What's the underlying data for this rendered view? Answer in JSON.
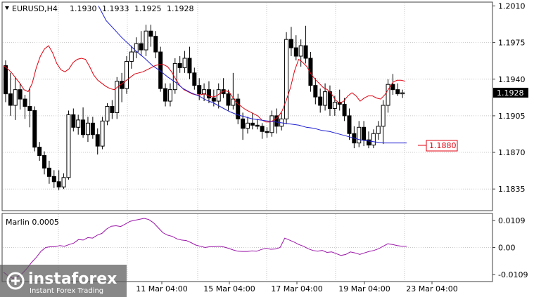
{
  "header": {
    "symbol": "EURUSD,H4",
    "open": "1.1930",
    "high": "1.1933",
    "low": "1.1925",
    "close": "1.1928"
  },
  "indicator": {
    "label": "Marlin 0.0005"
  },
  "watermark": {
    "brand": "instaforex",
    "tagline": "Instant Forex Trading"
  },
  "colors": {
    "background": "#ffffff",
    "plot_background": "#ffffff",
    "grid": "#c8c8c8",
    "candle": "#000000",
    "red_line": "#e0000f",
    "blue_line": "#1e1ed2",
    "oscillator": "#9b16a8",
    "price_tag_bg": "#000000",
    "level_tag": "#e0000f"
  },
  "chart_data": [
    {
      "type": "candlestick",
      "title": "EURUSD,H4",
      "y_ticks": [
        "1.2010",
        "1.1975",
        "1.1940",
        "1.1905",
        "1.1870",
        "1.1835"
      ],
      "x_ticks": [
        "11 Mar 04:00",
        "15 Mar 04:00",
        "17 Mar 04:00",
        "19 Mar 04:00",
        "23 Mar 04:00"
      ],
      "ylim": [
        1.1815,
        1.2013
      ],
      "grid": true,
      "current_price": "1.1928",
      "level_label": "1.1880",
      "ohlc": [
        [
          1.1953,
          1.1958,
          1.1918,
          1.1926
        ],
        [
          1.1926,
          1.1946,
          1.1905,
          1.1915
        ],
        [
          1.1915,
          1.1942,
          1.1901,
          1.193
        ],
        [
          1.193,
          1.1936,
          1.1911,
          1.1921
        ],
        [
          1.1921,
          1.1925,
          1.1902,
          1.1914
        ],
        [
          1.1914,
          1.1932,
          1.1894,
          1.191
        ],
        [
          1.191,
          1.1914,
          1.1871,
          1.1875
        ],
        [
          1.1875,
          1.188,
          1.1862,
          1.1867
        ],
        [
          1.1867,
          1.1871,
          1.1849,
          1.1855
        ],
        [
          1.1855,
          1.1862,
          1.184,
          1.1847
        ],
        [
          1.1847,
          1.1853,
          1.1836,
          1.1842
        ],
        [
          1.1842,
          1.1853,
          1.1834,
          1.1837
        ],
        [
          1.1837,
          1.185,
          1.1835,
          1.1846
        ],
        [
          1.1846,
          1.191,
          1.1844,
          1.1906
        ],
        [
          1.1906,
          1.1912,
          1.189,
          1.1894
        ],
        [
          1.1894,
          1.1906,
          1.1887,
          1.1901
        ],
        [
          1.1901,
          1.1913,
          1.1884,
          1.1887
        ],
        [
          1.1887,
          1.1904,
          1.188,
          1.1898
        ],
        [
          1.1898,
          1.1904,
          1.1883,
          1.1887
        ],
        [
          1.1887,
          1.1893,
          1.1868,
          1.1876
        ],
        [
          1.1876,
          1.1904,
          1.1873,
          1.19
        ],
        [
          1.19,
          1.1917,
          1.1896,
          1.1914
        ],
        [
          1.1914,
          1.192,
          1.1902,
          1.1908
        ],
        [
          1.1908,
          1.1942,
          1.1902,
          1.1938
        ],
        [
          1.1938,
          1.1946,
          1.1918,
          1.1931
        ],
        [
          1.1931,
          1.1962,
          1.1926,
          1.1957
        ],
        [
          1.1957,
          1.1972,
          1.195,
          1.1966
        ],
        [
          1.1966,
          1.198,
          1.196,
          1.1974
        ],
        [
          1.1974,
          1.1986,
          1.1962,
          1.1968
        ],
        [
          1.1968,
          1.1992,
          1.1962,
          1.1986
        ],
        [
          1.1986,
          1.1992,
          1.1971,
          1.1981
        ],
        [
          1.1981,
          1.1986,
          1.196,
          1.1966
        ],
        [
          1.1966,
          1.1971,
          1.1928,
          1.1931
        ],
        [
          1.1931,
          1.1936,
          1.1914,
          1.1919
        ],
        [
          1.1919,
          1.1936,
          1.1914,
          1.193
        ],
        [
          1.193,
          1.196,
          1.1926,
          1.1955
        ],
        [
          1.1955,
          1.1962,
          1.1946,
          1.1951
        ],
        [
          1.1951,
          1.1967,
          1.1946,
          1.196
        ],
        [
          1.196,
          1.1971,
          1.194,
          1.1946
        ],
        [
          1.1946,
          1.1951,
          1.193,
          1.1934
        ],
        [
          1.1934,
          1.1941,
          1.192,
          1.1926
        ],
        [
          1.1926,
          1.1936,
          1.1919,
          1.193
        ],
        [
          1.193,
          1.1938,
          1.1917,
          1.1922
        ],
        [
          1.1922,
          1.193,
          1.1914,
          1.1919
        ],
        [
          1.1919,
          1.1936,
          1.1912,
          1.193
        ],
        [
          1.193,
          1.1941,
          1.1922,
          1.1926
        ],
        [
          1.1926,
          1.193,
          1.191,
          1.1915
        ],
        [
          1.1915,
          1.1946,
          1.1911,
          1.1921
        ],
        [
          1.1921,
          1.1926,
          1.1897,
          1.1902
        ],
        [
          1.1902,
          1.1908,
          1.1882,
          1.1893
        ],
        [
          1.1893,
          1.1904,
          1.1888,
          1.1898
        ],
        [
          1.1898,
          1.1908,
          1.1892,
          1.1896
        ],
        [
          1.1896,
          1.1902,
          1.1892,
          1.1895
        ],
        [
          1.1895,
          1.1898,
          1.1883,
          1.189
        ],
        [
          1.189,
          1.1894,
          1.1884,
          1.1889
        ],
        [
          1.1889,
          1.191,
          1.1885,
          1.1905
        ],
        [
          1.1905,
          1.1912,
          1.1888,
          1.1895
        ],
        [
          1.1895,
          1.1908,
          1.1891,
          1.1902
        ],
        [
          1.1902,
          1.1985,
          1.1897,
          1.1978
        ],
        [
          1.1978,
          1.199,
          1.1962,
          1.197
        ],
        [
          1.197,
          1.1982,
          1.1958,
          1.1962
        ],
        [
          1.1962,
          1.1978,
          1.1952,
          1.1972
        ],
        [
          1.1972,
          1.1991,
          1.1955,
          1.196
        ],
        [
          1.196,
          1.1966,
          1.1928,
          1.1934
        ],
        [
          1.1934,
          1.1941,
          1.1916,
          1.1923
        ],
        [
          1.1923,
          1.1931,
          1.1908,
          1.1915
        ],
        [
          1.1915,
          1.1936,
          1.191,
          1.1928
        ],
        [
          1.1928,
          1.1934,
          1.1905,
          1.1912
        ],
        [
          1.1912,
          1.1924,
          1.1905,
          1.1918
        ],
        [
          1.1918,
          1.193,
          1.191,
          1.1916
        ],
        [
          1.1916,
          1.1922,
          1.19,
          1.1905
        ],
        [
          1.1905,
          1.1912,
          1.1882,
          1.1888
        ],
        [
          1.1888,
          1.1895,
          1.1874,
          1.1879
        ],
        [
          1.1879,
          1.19,
          1.1875,
          1.1894
        ],
        [
          1.1894,
          1.19,
          1.1876,
          1.1882
        ],
        [
          1.1882,
          1.189,
          1.1874,
          1.1877
        ],
        [
          1.1877,
          1.1892,
          1.1874,
          1.1888
        ],
        [
          1.1888,
          1.19,
          1.1882,
          1.1895
        ],
        [
          1.1895,
          1.192,
          1.1878,
          1.1915
        ],
        [
          1.1915,
          1.194,
          1.1908,
          1.1935
        ],
        [
          1.1935,
          1.1945,
          1.1925,
          1.193
        ],
        [
          1.193,
          1.1936,
          1.1924,
          1.1926
        ],
        [
          1.1926,
          1.193,
          1.1922,
          1.1927
        ]
      ],
      "red_line": [
        1.1953,
        1.195,
        1.1946,
        1.1941,
        1.1936,
        1.193,
        1.1928,
        1.1936,
        1.1951,
        1.1962,
        1.1969,
        1.1972,
        1.1965,
        1.1955,
        1.1949,
        1.1947,
        1.195,
        1.1956,
        1.1959,
        1.196,
        1.1959,
        1.1952,
        1.1944,
        1.1939,
        1.1936,
        1.1933,
        1.1931,
        1.193,
        1.1933,
        1.1936,
        1.1939,
        1.1942,
        1.1945,
        1.1946,
        1.1947,
        1.1949,
        1.1951,
        1.1953,
        1.1954,
        1.1954,
        1.1952,
        1.1947,
        1.194,
        1.1934,
        1.193,
        1.1928,
        1.1926,
        1.1925,
        1.1925,
        1.1926,
        1.1924,
        1.1923,
        1.1924,
        1.1927,
        1.1929,
        1.1928,
        1.1922,
        1.1917,
        1.1914,
        1.1911,
        1.1909,
        1.1907,
        1.1905,
        1.1901,
        1.1899,
        1.1899,
        1.1901,
        1.1904,
        1.191,
        1.192,
        1.1932,
        1.1948,
        1.1959,
        1.1956,
        1.1952,
        1.1945,
        1.194,
        1.1936,
        1.1932,
        1.193,
        1.1926,
        1.192,
        1.1917,
        1.1919,
        1.1924,
        1.1927,
        1.1924,
        1.1919,
        1.1922,
        1.1924,
        1.1924,
        1.1922,
        1.1921,
        1.1925,
        1.1931,
        1.1937,
        1.1939,
        1.1939,
        1.1938
      ],
      "blue_line": [
        1.201,
        1.1996,
        1.1988,
        1.198,
        1.1973,
        1.1966,
        1.196,
        1.1953,
        1.1948,
        1.1942,
        1.1937,
        1.1931,
        1.1927,
        1.1924,
        1.192,
        1.1917,
        1.1913,
        1.1909,
        1.1906,
        1.1904,
        1.1902,
        1.1901,
        1.19,
        1.1899,
        1.1898,
        1.1897,
        1.1896,
        1.1894,
        1.1893,
        1.1891,
        1.189,
        1.1888,
        1.1886,
        1.1884,
        1.1882,
        1.1881,
        1.188,
        1.1879,
        1.1879,
        1.1879,
        1.1879
      ]
    },
    {
      "type": "line",
      "title": "Marlin 0.0005",
      "y_ticks": [
        "0.0109",
        "0.00",
        "-0.0109"
      ],
      "ylim": [
        -0.0135,
        0.0135
      ],
      "series": [
        {
          "values": [
            -0.01,
            -0.0115,
            -0.0125,
            -0.0118,
            -0.0105,
            -0.0085,
            -0.006,
            -0.004,
            -0.0015,
            0.0,
            0.0003,
            0.0003,
            0.0008,
            0.0005,
            0.0012,
            0.0018,
            0.0032,
            0.003,
            0.004,
            0.0038,
            0.005,
            0.0057,
            0.0075,
            0.0086,
            0.0088,
            0.0085,
            0.0095,
            0.0106,
            0.011,
            0.0114,
            0.0118,
            0.0113,
            0.01,
            0.008,
            0.006,
            0.005,
            0.0045,
            0.0035,
            0.003,
            0.0028,
            0.002,
            0.001,
            0.0005,
            0.0,
            0.0003,
            0.0003,
            0.0005,
            0.0002,
            -0.0003,
            -0.001,
            -0.0015,
            -0.0016,
            -0.0016,
            -0.0014,
            -0.0015,
            -0.0008,
            -0.0003,
            -0.0007,
            -0.0006,
            0.0,
            0.0038,
            0.003,
            0.0022,
            0.0012,
            0.0005,
            -0.0005,
            -0.0012,
            -0.0015,
            -0.0012,
            -0.002,
            -0.0018,
            -0.0025,
            -0.0032,
            -0.0028,
            -0.0018,
            -0.0022,
            -0.0028,
            -0.0022,
            -0.0016,
            -0.0012,
            -0.0005,
            0.0005,
            0.0015,
            0.0012,
            0.0008,
            0.0005,
            0.0005
          ]
        }
      ]
    }
  ]
}
